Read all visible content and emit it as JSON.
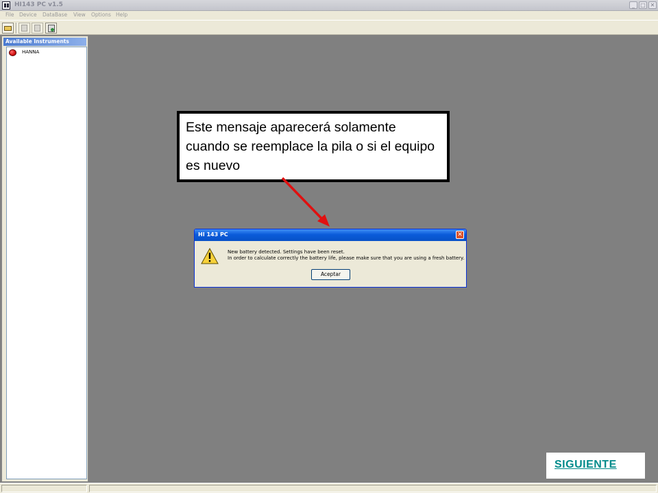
{
  "window": {
    "title": "HI143 PC v1.5",
    "controls": {
      "minimize": "_",
      "maximize": "□",
      "close": "✕"
    }
  },
  "menu": [
    "File",
    "Device",
    "DataBase",
    "View",
    "Options",
    "Help"
  ],
  "toolbar": {
    "buttons": [
      {
        "icon": "open-folder-icon",
        "enabled": true
      },
      {
        "icon": "settings-icon",
        "enabled": false
      },
      {
        "icon": "edit-icon",
        "enabled": false
      },
      {
        "icon": "download-icon",
        "enabled": true
      }
    ]
  },
  "side_panel": {
    "title": "Available Instruments",
    "instruments": [
      {
        "name": "HANNA",
        "status_color": "#d00000"
      }
    ]
  },
  "callout": {
    "text": "Este mensaje aparecerá solamente cuando se reemplace la pila o si el equipo es nuevo"
  },
  "dialog": {
    "title": "HI 143 PC",
    "close_label": "✕",
    "message_lines": [
      "New battery detected. Settings have been reset.",
      "In order to calculate correctly the battery life, please make sure that you are using a fresh battery."
    ],
    "button_label": "Aceptar",
    "icon": "warning-icon"
  },
  "next_link": {
    "label": "SIGUIENTE"
  },
  "colors": {
    "workspace": "#808080",
    "arrow": "#e01010",
    "link": "#008b8b",
    "dialog_title": "#0a5bd9"
  }
}
